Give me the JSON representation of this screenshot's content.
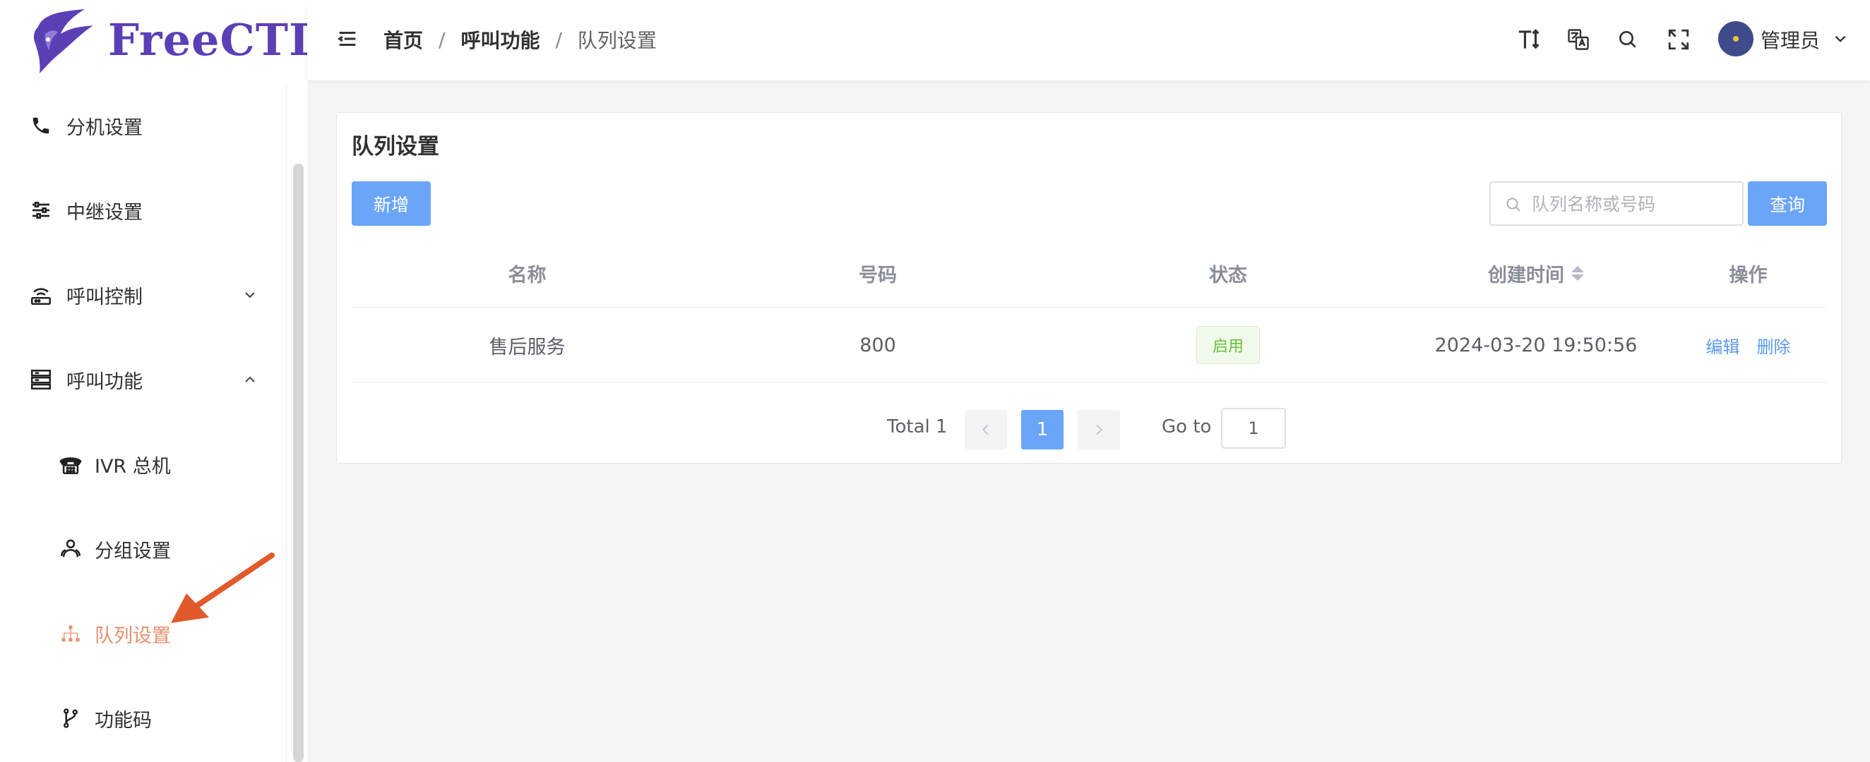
{
  "brand": {
    "name": "FreeCTI",
    "color": "#5b3fb5"
  },
  "sidebar": {
    "items": [
      {
        "label": "分机设置",
        "icon": "phone-icon"
      },
      {
        "label": "中继设置",
        "icon": "sliders-icon"
      },
      {
        "label": "呼叫控制",
        "icon": "router-icon",
        "expanded": false
      },
      {
        "label": "呼叫功能",
        "icon": "server-icon",
        "expanded": true
      },
      {
        "label": "IVR 总机",
        "icon": "telephone-icon"
      },
      {
        "label": "分组设置",
        "icon": "group-icon"
      },
      {
        "label": "队列设置",
        "icon": "sitemap-icon",
        "active": true
      },
      {
        "label": "功能码",
        "icon": "branch-icon"
      }
    ]
  },
  "header": {
    "breadcrumb": [
      "首页",
      "呼叫功能",
      "队列设置"
    ],
    "separator": "/",
    "user": "管理员",
    "icons": [
      "font-size-icon",
      "translate-icon",
      "search-icon",
      "fullscreen-icon"
    ]
  },
  "main": {
    "title": "队列设置",
    "add_label": "新增",
    "search_placeholder": "队列名称或号码",
    "search_value": "",
    "query_label": "查询",
    "columns": [
      "名称",
      "号码",
      "状态",
      "创建时间",
      "操作"
    ],
    "rows": [
      {
        "name": "售后服务",
        "number": "800",
        "status": "启用",
        "created": "2024-03-20 19:50:56",
        "edit": "编辑",
        "delete": "删除"
      }
    ],
    "pagination": {
      "total": "Total 1",
      "current": "1",
      "goto_label": "Go to",
      "goto_value": "1"
    }
  },
  "colors": {
    "primary": "#6ba5f7",
    "active_menu": "#e8906f",
    "status_ok": "#67c23a",
    "annotation_arrow": "#e05a2b"
  }
}
